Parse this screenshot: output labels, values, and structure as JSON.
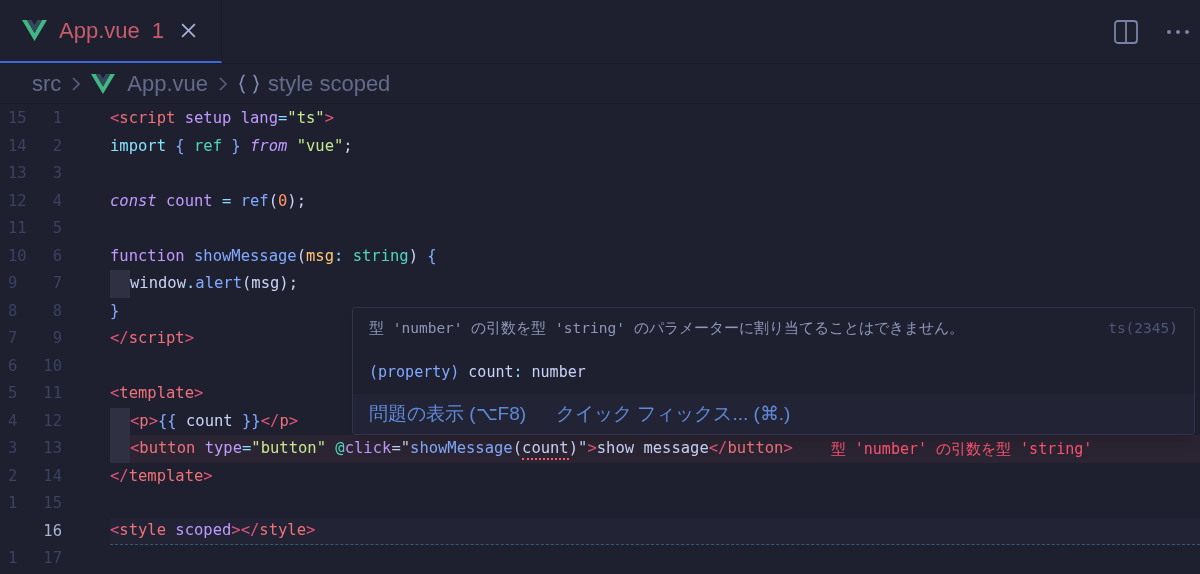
{
  "tabs": [
    {
      "label": "App.vue",
      "problems": "1",
      "has_error": true,
      "selected": true
    }
  ],
  "breadcrumb": [
    {
      "label": "src",
      "kind": "folder"
    },
    {
      "label": "App.vue",
      "kind": "vue-file"
    },
    {
      "label": "style scoped",
      "kind": "symbol"
    }
  ],
  "code_lines": [
    {
      "relative": "15",
      "number": "1",
      "tokens": [
        {
          "t": "<",
          "kind": "bracket"
        },
        {
          "t": "script",
          "kind": "tag"
        },
        {
          "t": " setup lang",
          "kind": "attr"
        },
        {
          "t": "=",
          "kind": "op"
        },
        {
          "t": "\"ts\"",
          "kind": "str"
        },
        {
          "t": ">",
          "kind": "bracket"
        }
      ]
    },
    {
      "relative": "14",
      "number": "2",
      "tokens": [
        {
          "t": "import ",
          "kind": "kw2"
        },
        {
          "t": "{ ",
          "kind": "punct"
        },
        {
          "t": "ref ",
          "kind": "fn2"
        },
        {
          "t": "} ",
          "kind": "punct"
        },
        {
          "t": "from ",
          "kind": "kwi"
        },
        {
          "t": "\"vue\"",
          "kind": "str"
        },
        {
          "t": ";",
          "kind": "text"
        }
      ]
    },
    {
      "relative": "13",
      "number": "3"
    },
    {
      "relative": "12",
      "number": "4",
      "tokens": [
        {
          "t": "const ",
          "kind": "kwi"
        },
        {
          "t": "count ",
          "kind": "var"
        },
        {
          "t": "= ",
          "kind": "op"
        },
        {
          "t": "ref",
          "kind": "fn"
        },
        {
          "t": "(",
          "kind": "text"
        },
        {
          "t": "0",
          "kind": "num"
        },
        {
          "t": ");",
          "kind": "text"
        }
      ]
    },
    {
      "relative": "11",
      "number": "5"
    },
    {
      "relative": "10",
      "number": "6",
      "tokens": [
        {
          "t": "function ",
          "kind": "kw"
        },
        {
          "t": "showMessage",
          "kind": "fn"
        },
        {
          "t": "(",
          "kind": "text"
        },
        {
          "t": "msg",
          "kind": "param"
        },
        {
          "t": ":",
          "kind": "op"
        },
        {
          "t": " string",
          "kind": "type"
        },
        {
          "t": ") ",
          "kind": "text"
        },
        {
          "t": "{",
          "kind": "punct"
        }
      ]
    },
    {
      "relative": "9",
      "number": "7",
      "indented": true,
      "tokens": [
        {
          "t": "window",
          "kind": "text"
        },
        {
          "t": ".",
          "kind": "op"
        },
        {
          "t": "alert",
          "kind": "fn"
        },
        {
          "t": "(msg);",
          "kind": "text"
        }
      ]
    },
    {
      "relative": "8",
      "number": "8",
      "tokens": [
        {
          "t": "}",
          "kind": "punct"
        }
      ]
    },
    {
      "relative": "7",
      "number": "9",
      "tokens": [
        {
          "t": "</",
          "kind": "bracket"
        },
        {
          "t": "script",
          "kind": "tag"
        },
        {
          "t": ">",
          "kind": "bracket"
        }
      ]
    },
    {
      "relative": "6",
      "number": "10"
    },
    {
      "relative": "5",
      "number": "11",
      "tokens": [
        {
          "t": "<",
          "kind": "bracket"
        },
        {
          "t": "template",
          "kind": "tag"
        },
        {
          "t": ">",
          "kind": "bracket"
        }
      ]
    },
    {
      "relative": "4",
      "number": "12",
      "indented": true,
      "tokens": [
        {
          "t": "<",
          "kind": "bracket"
        },
        {
          "t": "p",
          "kind": "tag"
        },
        {
          "t": ">",
          "kind": "bracket"
        },
        {
          "t": "{{",
          "kind": "punct"
        },
        {
          "t": " count ",
          "kind": "text"
        },
        {
          "t": "}}",
          "kind": "punct"
        },
        {
          "t": "</",
          "kind": "bracket"
        },
        {
          "t": "p",
          "kind": "tag"
        },
        {
          "t": ">",
          "kind": "bracket"
        }
      ]
    },
    {
      "relative": "3",
      "number": "13",
      "indented": true,
      "error": "型 'number' の引数を型 'string'",
      "tokens": [
        {
          "t": "<",
          "kind": "bracket"
        },
        {
          "t": "button",
          "kind": "tag"
        },
        {
          "t": " type",
          "kind": "attr"
        },
        {
          "t": "=",
          "kind": "op"
        },
        {
          "t": "\"button\" ",
          "kind": "str"
        },
        {
          "t": "@",
          "kind": "fn2"
        },
        {
          "t": "click",
          "kind": "attr"
        },
        {
          "t": "=\"",
          "kind": "text"
        },
        {
          "t": "showMessage",
          "kind": "fn"
        },
        {
          "t": "(",
          "kind": "text"
        },
        {
          "t": "count",
          "kind": "text",
          "squiggle": true
        },
        {
          "t": ")\"",
          "kind": "text"
        },
        {
          "t": ">",
          "kind": "bracket"
        },
        {
          "t": "show message",
          "kind": "text"
        },
        {
          "t": "</",
          "kind": "bracket"
        },
        {
          "t": "button",
          "kind": "tag"
        },
        {
          "t": ">",
          "kind": "bracket"
        }
      ]
    },
    {
      "relative": "2",
      "number": "14",
      "tokens": [
        {
          "t": "</",
          "kind": "bracket"
        },
        {
          "t": "template",
          "kind": "tag"
        },
        {
          "t": ">",
          "kind": "bracket"
        }
      ]
    },
    {
      "relative": "1",
      "number": "15"
    },
    {
      "number": "16",
      "current": true,
      "tokens": [
        {
          "t": "<",
          "kind": "bracket"
        },
        {
          "t": "style",
          "kind": "tag"
        },
        {
          "t": " scoped",
          "kind": "attr"
        },
        {
          "t": ">",
          "kind": "bracket"
        },
        {
          "t": "</",
          "kind": "bracket"
        },
        {
          "t": "style",
          "kind": "tag"
        },
        {
          "t": ">",
          "kind": "bracket"
        }
      ]
    },
    {
      "relative": "1",
      "number": "17"
    }
  ],
  "hover": {
    "message": "型 'number' の引数を型 'string' のパラメーターに割り当てることはできません。",
    "code": "ts(2345)",
    "signature": [
      {
        "t": "(property)",
        "kind": "fn"
      },
      {
        "t": " count",
        "kind": "text"
      },
      {
        "t": ":",
        "kind": "op"
      },
      {
        "t": " number",
        "kind": "text"
      }
    ],
    "actions": [
      "問題の表示 (⌥F8)",
      "クイック フィックス... (⌘.)"
    ]
  }
}
